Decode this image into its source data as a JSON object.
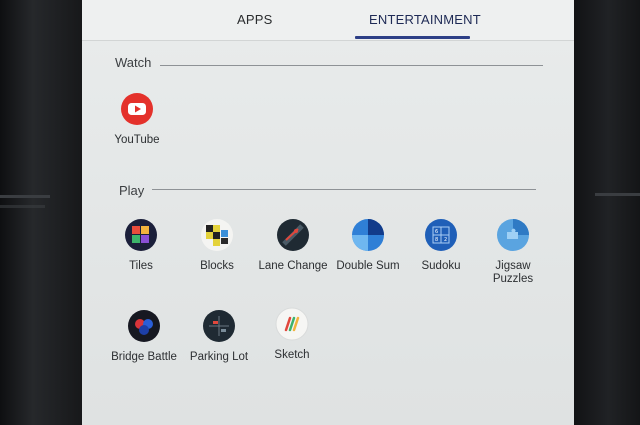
{
  "tabs": {
    "apps": "APPS",
    "entertainment": "ENTERTAINMENT",
    "active": "entertainment"
  },
  "sections": {
    "watch": "Watch",
    "play": "Play"
  },
  "apps": {
    "youtube": {
      "label": "YouTube",
      "icon": "youtube-icon"
    },
    "tiles": {
      "label": "Tiles",
      "icon": "tiles-icon"
    },
    "blocks": {
      "label": "Blocks",
      "icon": "blocks-icon"
    },
    "lane_change": {
      "label": "Lane Change",
      "icon": "lane-change-icon"
    },
    "double_sum": {
      "label": "Double Sum",
      "icon": "double-sum-icon"
    },
    "sudoku": {
      "label": "Sudoku",
      "icon": "sudoku-icon"
    },
    "jigsaw": {
      "label_line1": "Jigsaw",
      "label_line2": "Puzzles",
      "icon": "jigsaw-puzzles-icon"
    },
    "bridge_battle": {
      "label": "Bridge Battle",
      "icon": "bridge-battle-icon"
    },
    "parking_lot": {
      "label": "Parking Lot",
      "icon": "parking-lot-icon"
    },
    "sketch": {
      "label": "Sketch",
      "icon": "sketch-icon"
    }
  },
  "colors": {
    "accent": "#2d3f86",
    "youtube_red": "#e4312b"
  }
}
